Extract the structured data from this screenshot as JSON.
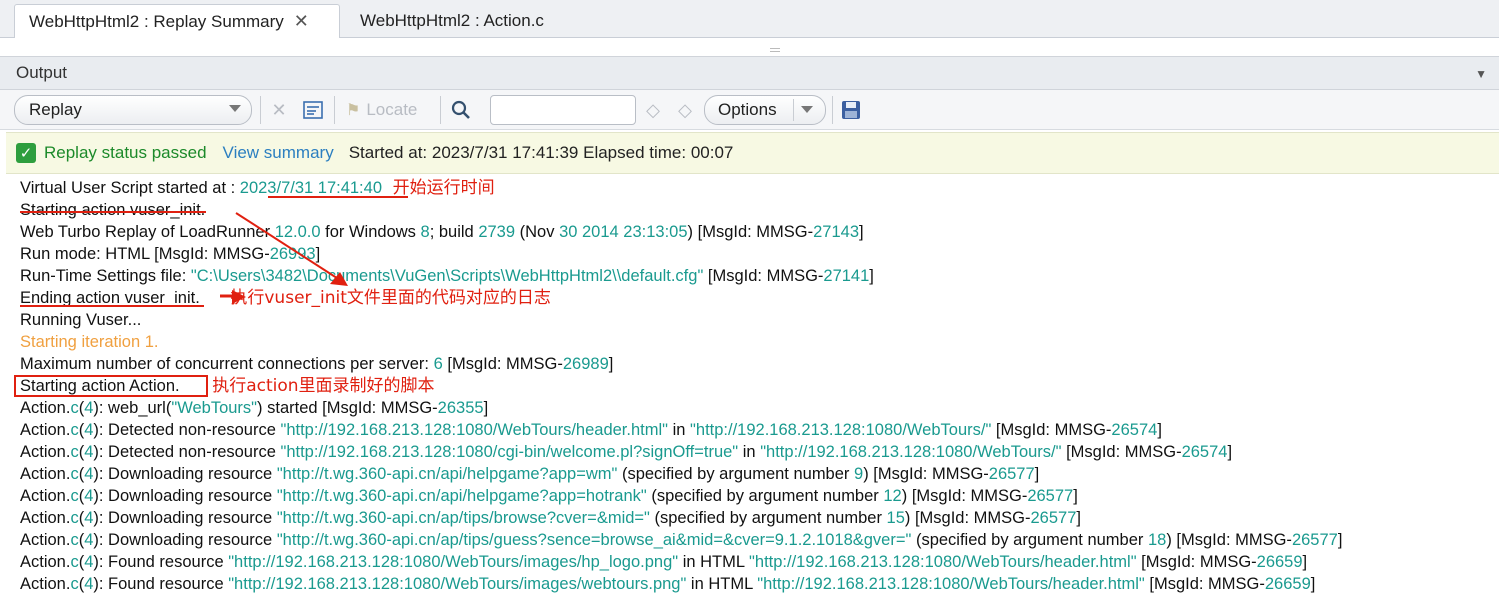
{
  "tabs": [
    {
      "label": "WebHttpHtml2 : Replay Summary",
      "close": "✕"
    },
    {
      "label": "WebHttpHtml2 : Action.c"
    }
  ],
  "output": {
    "title": "Output"
  },
  "toolbar": {
    "replay_select": "Replay",
    "locate": "Locate",
    "search_value": "",
    "options": "Options"
  },
  "status": {
    "passed": "Replay status passed",
    "view_summary": "View summary",
    "info": "Started at: 2023/7/31 17:41:39 Elapsed time: 00:07"
  },
  "annotations": {
    "a1": "开始运行时间",
    "a2": "执行vuser_init文件里面的代码对应的日志",
    "a3": "执行action里面录制好的脚本"
  },
  "log": {
    "l1a": "Virtual User Script started at : ",
    "l1b": "2023/7/31 17:41:40",
    "l2": "Starting action vuser_init.",
    "l3a": "Web Turbo Replay of LoadRunner ",
    "l3b": "12.0.0",
    "l3c": " for Windows ",
    "l3d": "8",
    "l3e": "; build ",
    "l3f": "2739",
    "l3g": " (Nov ",
    "l3h": "30 2014 23:13:05",
    "l3i": ")       [MsgId: MMSG-",
    "l3j": "27143",
    "l3k": "]",
    "l4a": "Run mode: HTML    [MsgId: MMSG-",
    "l4b": "26993",
    "l4c": "]",
    "l5a": "Run-Time Settings file: ",
    "l5b": "\"C:\\Users\\3482\\Documents\\VuGen\\Scripts\\WebHttpHtml2\\\\default.cfg\"",
    "l5c": "    [MsgId: MMSG-",
    "l5d": "27141",
    "l5e": "]",
    "l6": "Ending action vuser_init.",
    "l7": "Running Vuser...",
    "l8": "Starting iteration 1.",
    "l9a": "Maximum number of concurrent connections per server: ",
    "l9b": "6",
    "l9c": "    [MsgId: MMSG-",
    "l9d": "26989",
    "l9e": "]",
    "l10": "Starting action Action.",
    "l11a": "Action.",
    "l11b": "c",
    "l11c": "(",
    "l11d": "4",
    "l11e": "): web_url(",
    "l11f": "\"WebTours\"",
    "l11g": ") started      [MsgId: MMSG-",
    "l11h": "26355",
    "l11i": "]",
    "l12a": "): Detected non-resource ",
    "l12b": "\"http://192.168.213.128:1080/WebTours/header.html\"",
    "l12c": " in ",
    "l12d": "\"http://192.168.213.128:1080/WebTours/\"",
    "l12e": "      [MsgId: MMSG-",
    "l12f": "26574",
    "l12g": "]",
    "l13b": "\"http://192.168.213.128:1080/cgi-bin/welcome.pl?signOff=true\"",
    "l13d": "\"http://192.168.213.128:1080/WebTours/\"",
    "l13e": "     [MsgId: MMSG-",
    "l13f": "26574",
    "l14a": "): Downloading resource ",
    "l14b": "\"http://t.wg.360-api.cn/api/helpgame?app=wm\"",
    "l14c": " (specified by argument number ",
    "l14d": "9",
    "l14e": ")        [MsgId: MMSG-",
    "l14f": "26577",
    "l15b": "\"http://t.wg.360-api.cn/api/helpgame?app=hotrank\"",
    "l15d": "12",
    "l15e": ")       [MsgId: MMSG-",
    "l15f": "26577",
    "l16b": "\"http://t.wg.360-api.cn/ap/tips/browse?cver=&mid=\"",
    "l16d": "15",
    "l16e": ")       [MsgId: MMSG-",
    "l16f": "26577",
    "l17b": "\"http://t.wg.360-api.cn/ap/tips/guess?sence=browse_ai&mid=&cver=9.1.2.1018&gver=\"",
    "l17d": "18",
    "l17e": ")      [MsgId: MMSG-",
    "l17f": "26577",
    "l18a": "): Found resource ",
    "l18b": "\"http://192.168.213.128:1080/WebTours/images/hp_logo.png\"",
    "l18c": " in HTML ",
    "l18d": "\"http://192.168.213.128:1080/WebTours/header.html\"",
    "l18e": "      [MsgId: MMSG-",
    "l18f": "26659",
    "l19b": "\"http://192.168.213.128:1080/WebTours/images/webtours.png\"",
    "l19d": "\"http://192.168.213.128:1080/WebTours/header.html\"",
    "l19e": "      [MsgId: MMSG-",
    "l19f": "26659"
  },
  "colors": {
    "teal": "#1a9a8f",
    "annotation_red": "#e02010",
    "passed_green": "#1c8a2a",
    "link_blue": "#2c7fc0"
  }
}
